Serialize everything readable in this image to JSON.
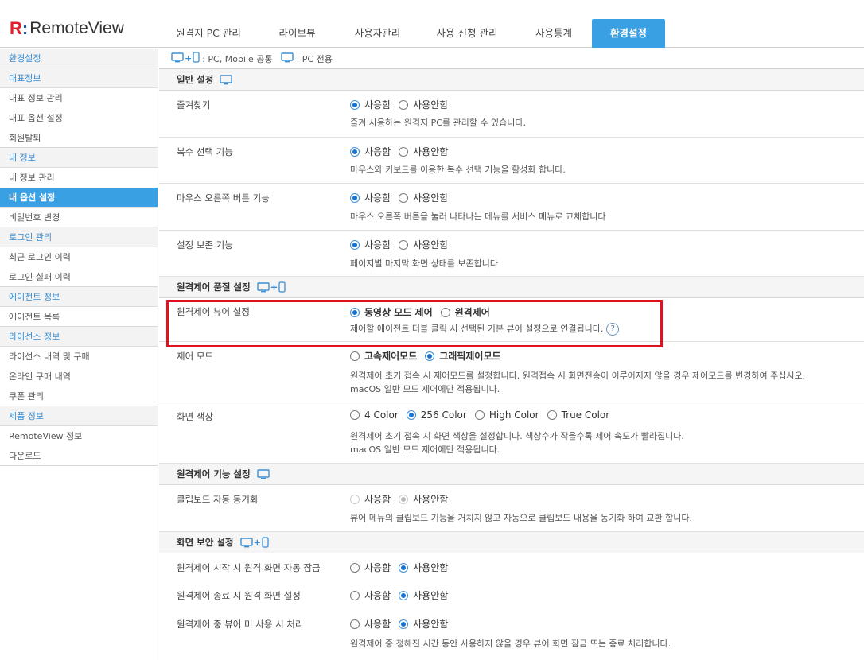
{
  "brand": {
    "mark": "R",
    "colon": ":",
    "name": "RemoteView"
  },
  "tabs": [
    {
      "label": "원격지 PC 관리"
    },
    {
      "label": "라이브뷰"
    },
    {
      "label": "사용자관리"
    },
    {
      "label": "사용 신청 관리"
    },
    {
      "label": "사용통계"
    },
    {
      "label": "환경설정",
      "active": true
    }
  ],
  "sidebar": {
    "items": [
      {
        "label": "환경설정",
        "type": "head"
      },
      {
        "label": "대표정보",
        "type": "head"
      },
      {
        "label": "대표 정보 관리",
        "type": "sub"
      },
      {
        "label": "대표 옵션 설정",
        "type": "sub"
      },
      {
        "label": "회원탈퇴",
        "type": "sub"
      },
      {
        "label": "내 정보",
        "type": "head"
      },
      {
        "label": "내 정보 관리",
        "type": "sub"
      },
      {
        "label": "내 옵션 설정",
        "type": "active"
      },
      {
        "label": "비밀번호 변경",
        "type": "sub"
      },
      {
        "label": "로그인 관리",
        "type": "head"
      },
      {
        "label": "최근 로그인 이력",
        "type": "sub"
      },
      {
        "label": "로그인 실패 이력",
        "type": "sub"
      },
      {
        "label": "에이전트 정보",
        "type": "head"
      },
      {
        "label": "에이전트 목록",
        "type": "sub"
      },
      {
        "label": "라이선스 정보",
        "type": "head"
      },
      {
        "label": "라이선스 내역 및 구매",
        "type": "sub"
      },
      {
        "label": "온라인 구매 내역",
        "type": "sub"
      },
      {
        "label": "쿠폰 관리",
        "type": "sub"
      },
      {
        "label": "제품 정보",
        "type": "head"
      },
      {
        "label": "RemoteView 정보",
        "type": "sub"
      },
      {
        "label": "다운로드",
        "type": "sub"
      }
    ]
  },
  "legend": {
    "common": ": PC, Mobile 공통",
    "pc_only": ": PC 전용"
  },
  "sections": {
    "general": {
      "title": "일반 설정",
      "rows": [
        {
          "label": "즐겨찾기",
          "options": [
            "사용함",
            "사용안함"
          ],
          "selected": 0,
          "desc": "즐겨 사용하는 원격지 PC를 관리할 수 있습니다."
        },
        {
          "label": "복수 선택 기능",
          "options": [
            "사용함",
            "사용안함"
          ],
          "selected": 0,
          "desc": "마우스와 키보드를 이용한 복수 선택 기능을 활성화 합니다."
        },
        {
          "label": "마우스 오른쪽 버튼 기능",
          "options": [
            "사용함",
            "사용안함"
          ],
          "selected": 0,
          "desc": "마우스 오른쪽 버튼을 눌러 나타나는 메뉴를 서비스 메뉴로 교체합니다"
        },
        {
          "label": "설정 보존 기능",
          "options": [
            "사용함",
            "사용안함"
          ],
          "selected": 0,
          "desc": "페이지별 마지막 화면 상태를 보존합니다"
        }
      ]
    },
    "quality": {
      "title": "원격제어 품질 설정",
      "viewer": {
        "label": "원격제어 뷰어 설정",
        "options": [
          "동영상 모드 제어",
          "원격제어"
        ],
        "selected": 0,
        "desc": "제어할 에이전트 더블 클릭 시 선택된 기본 뷰어 설정으로 연결됩니다.",
        "help": "?"
      },
      "mode": {
        "label": "제어 모드",
        "options": [
          "고속제어모드",
          "그래픽제어모드"
        ],
        "selected": 1,
        "desc1": "원격제어 초기 접속 시 제어모드를 설정합니다. 원격접속 시 화면전송이 이루어지지 않을 경우 제어모드를 변경하여 주십시오.",
        "desc2": "macOS 일반 모드 제어에만 적용됩니다."
      },
      "color": {
        "label": "화면 색상",
        "options": [
          "4 Color",
          "256 Color",
          "High Color",
          "True Color"
        ],
        "selected": 1,
        "desc1": "원격제어 초기 접속 시 화면 색상을 설정합니다. 색상수가 작을수록 제어 속도가 빨라집니다.",
        "desc2": "macOS 일반 모드 제어에만 적용됩니다."
      }
    },
    "function": {
      "title": "원격제어 기능 설정",
      "clipboard": {
        "label": "클립보드 자동 동기화",
        "options": [
          "사용함",
          "사용안함"
        ],
        "selected": 1,
        "disabled": true,
        "desc": "뷰어 메뉴의 클립보드 기능을 거치지 않고 자동으로 클립보드 내용을 동기화 하여 교환 합니다."
      }
    },
    "security": {
      "title": "화면 보안 설정",
      "rows": [
        {
          "label": "원격제어 시작 시 원격 화면 자동 잠금",
          "options": [
            "사용함",
            "사용안함"
          ],
          "selected": 1
        },
        {
          "label": "원격제어 종료 시 원격 화면 설정",
          "options": [
            "사용함",
            "사용안함"
          ],
          "selected": 1
        },
        {
          "label": "원격제어 중 뷰어 미 사용 시 처리",
          "options": [
            "사용함",
            "사용안함"
          ],
          "selected": 1,
          "desc": "원격제어 중 정해진 시간 동안 사용하지 않을 경우 뷰어 화면 잠금 또는 종료 처리합니다."
        }
      ]
    }
  },
  "colors": {
    "accent": "#3aa0e4",
    "highlight": "#e0121c",
    "brand_red": "#e31d2d",
    "brand_blue": "#1a5aa8"
  },
  "icons": {
    "pc": "monitor-icon",
    "mobile": "mobile-icon",
    "plus": "plus-icon"
  }
}
